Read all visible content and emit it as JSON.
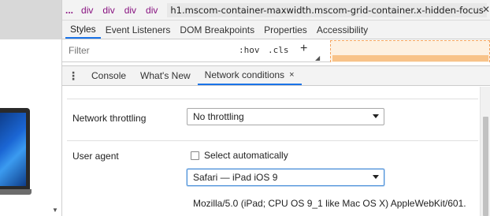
{
  "breadcrumbs": {
    "ellipsis": "...",
    "items": [
      "div",
      "div",
      "div",
      "div"
    ],
    "current": "h1.mscom-container-maxwidth.mscom-grid-container.x-hidden-focus"
  },
  "styles_tabs": [
    "Styles",
    "Event Listeners",
    "DOM Breakpoints",
    "Properties",
    "Accessibility"
  ],
  "filter": {
    "placeholder": "Filter",
    "hov": ":hov",
    "cls": ".cls",
    "plus": "+"
  },
  "drawer": {
    "tabs": [
      "Console",
      "What's New",
      "Network conditions"
    ],
    "active_tab": "Network conditions",
    "tab_close_glyph": "×",
    "drawer_close_glyph": "✕"
  },
  "network_conditions": {
    "throttling_label": "Network throttling",
    "throttling_value": "No throttling",
    "user_agent_label": "User agent",
    "select_auto_label": "Select automatically",
    "select_auto_checked": false,
    "user_agent_value": "Safari — iPad iOS 9",
    "user_agent_string": "Mozilla/5.0 (iPad; CPU OS 9_1 like Mac OS X) AppleWebKit/601."
  },
  "colors": {
    "accent": "#1a73e8",
    "crumb_tag": "#881280",
    "focus_border": "#4a90d9"
  }
}
